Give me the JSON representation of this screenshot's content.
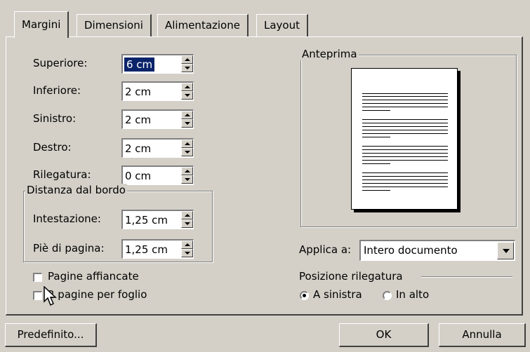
{
  "tabs": [
    {
      "label": "Margini",
      "active": true
    },
    {
      "label": "Dimensioni",
      "active": false
    },
    {
      "label": "Alimentazione",
      "active": false
    },
    {
      "label": "Layout",
      "active": false
    }
  ],
  "margins": {
    "top": {
      "label": "Superiore:",
      "value": "6 cm"
    },
    "bottom": {
      "label": "Inferiore:",
      "value": "2 cm"
    },
    "left": {
      "label": "Sinistro:",
      "value": "2 cm"
    },
    "right": {
      "label": "Destro:",
      "value": "2 cm"
    },
    "gutter": {
      "label": "Rilegatura:",
      "value": "0 cm"
    }
  },
  "edge_distance": {
    "title": "Distanza dal bordo",
    "header": {
      "label": "Intestazione:",
      "value": "1,25 cm"
    },
    "footer": {
      "label": "Piè di pagina:",
      "value": "1,25 cm"
    }
  },
  "checkboxes": {
    "mirror": {
      "label": "Pagine affiancate",
      "checked": false
    },
    "two_per_sheet": {
      "label": "2 pagine per foglio",
      "checked": false
    }
  },
  "preview": {
    "title": "Anteprima"
  },
  "apply_to": {
    "label": "Applica a:",
    "value": "Intero documento"
  },
  "gutter_position": {
    "title": "Posizione rilegatura",
    "left_label": "A sinistra",
    "top_label": "In alto",
    "selected": "left"
  },
  "buttons": {
    "default": "Predefinito...",
    "ok": "OK",
    "cancel": "Annulla"
  },
  "icons": {
    "cursor": "mouse-pointer-icon",
    "spin": "spin-arrows-icon",
    "dropdown": "chevron-down-icon"
  }
}
